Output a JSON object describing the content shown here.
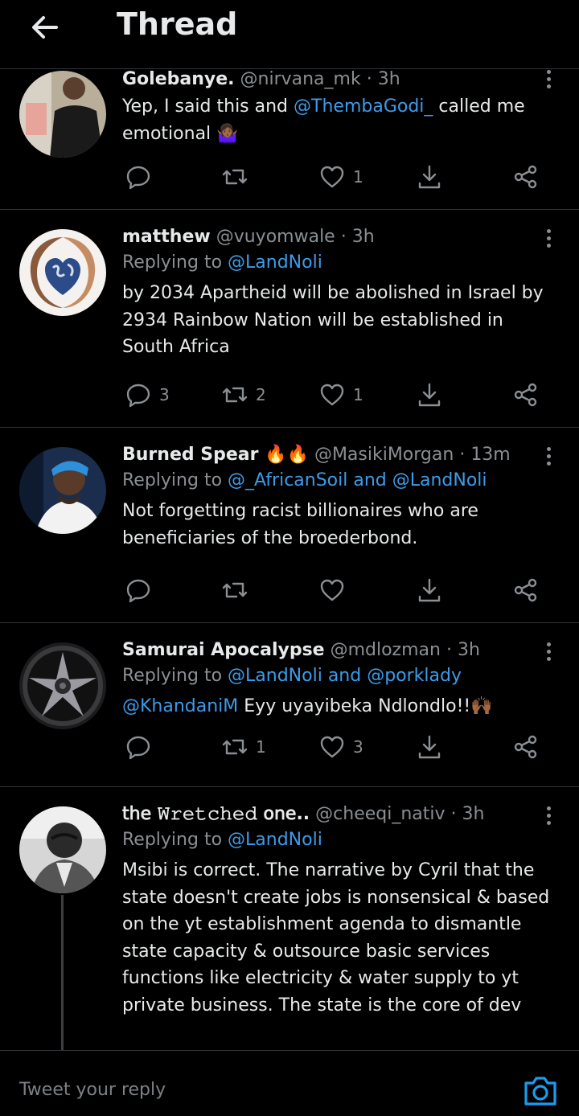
{
  "header": {
    "title": "Thread",
    "back_icon": "arrow-left-icon"
  },
  "colors": {
    "background": "#000000",
    "link": "#3d9be9",
    "muted": "#8b8f93",
    "divider": "#2f3336"
  },
  "tweets": [
    {
      "name": "Golebanye.",
      "handle": "@nirvana_mk",
      "time": "· 3h",
      "text_parts": [
        "Yep, I said this and ",
        "@ThembaGodi_",
        " called me emotional 🤷🏾‍♀️"
      ],
      "counts": {
        "replies": "",
        "retweets": "",
        "likes": "1"
      }
    },
    {
      "name": "matthew",
      "handle": "@vuyomwale",
      "time": "· 3h",
      "replying_prefix": "Replying to ",
      "replying_to": "@LandNoli",
      "text": "by 2034 Apartheid will be abolished in Israel by 2934 Rainbow Nation will be established in South Africa",
      "counts": {
        "replies": "3",
        "retweets": "2",
        "likes": "1"
      }
    },
    {
      "name": "Burned Spear 🔥🔥",
      "handle": "@MasikiMorgan",
      "time": "· 13m",
      "replying_prefix": "Replying to ",
      "replying_to": "@_AfricanSoil and @LandNoli",
      "text": "Not forgetting racist billionaires who are beneficiaries of the broederbond.",
      "counts": {
        "replies": "",
        "retweets": "",
        "likes": ""
      }
    },
    {
      "name": "Samurai Apocalypse",
      "handle": "@mdlozman",
      "time": "· 3h",
      "replying_prefix": "Replying to ",
      "replying_to": "@LandNoli and @porklady",
      "text_parts": [
        "@KhandaniM",
        " Eyy uyayibeka Ndlondlo!!🙌🏾"
      ],
      "counts": {
        "replies": "",
        "retweets": "1",
        "likes": "3"
      }
    },
    {
      "name": "𝗍𝗁𝖾 𝚆𝚛𝚎𝚝𝚌𝚑𝚎𝚍 𝗈𝗇𝖾..",
      "handle": "@cheeqi_nativ",
      "time": "· 3h",
      "replying_prefix": "Replying to ",
      "replying_to": "@LandNoli",
      "text": "Msibi is correct. The narrative by Cyril that the state doesn't create jobs is nonsensical & based on the yt establishment agenda to dismantle state capacity & outsource basic services functions like electricity & water supply to yt private business. The state is the core of dev"
    }
  ],
  "reply_bar": {
    "placeholder": "Tweet your reply",
    "camera_icon": "camera-icon"
  }
}
